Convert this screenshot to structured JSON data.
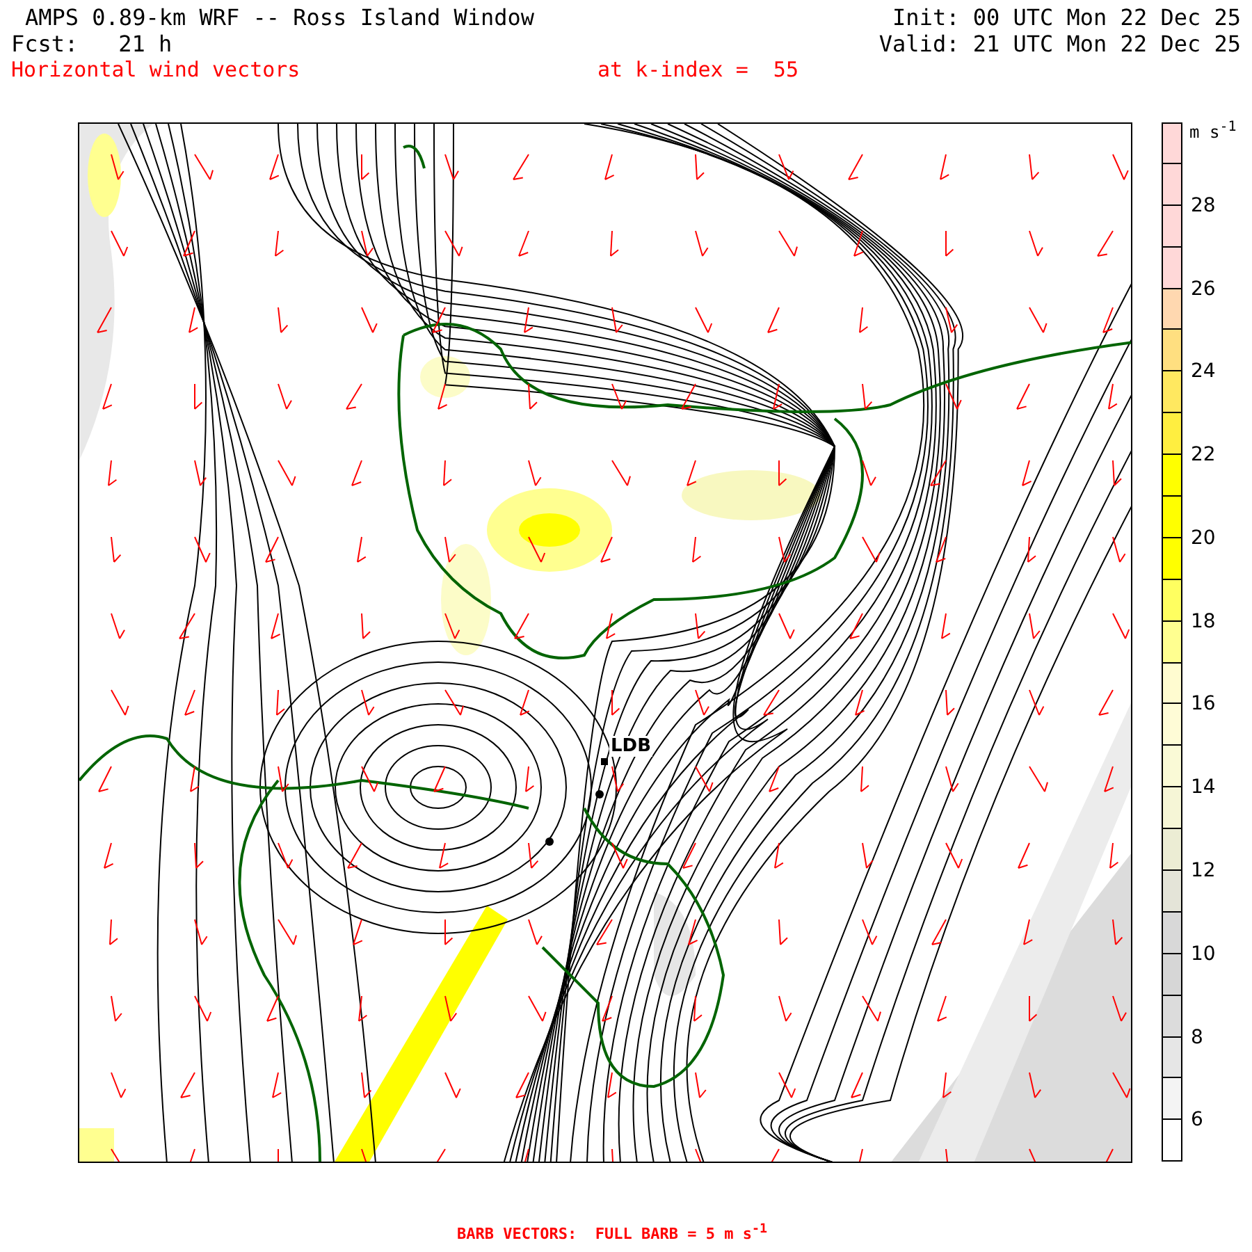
{
  "header": {
    "title": "AMPS 0.89-km WRF -- Ross Island Window",
    "init": "Init: 00 UTC Mon 22 Dec 25",
    "forecast": "Fcst:   21 h",
    "valid": "Valid: 21 UTC Mon 22 Dec 25",
    "field": "Horizontal wind vectors",
    "level": "at k-index =  55"
  },
  "map": {
    "station_label": "LDB"
  },
  "colorbar": {
    "unit": "m s$^{-1}$",
    "segments": [
      {
        "color": "#ffd8d8"
      },
      {
        "color": "#ffd8d8"
      },
      {
        "color": "#ffd8d8"
      },
      {
        "color": "#ffd8d8"
      },
      {
        "color": "#ffd8b0"
      },
      {
        "color": "#ffdf80"
      },
      {
        "color": "#ffe860"
      },
      {
        "color": "#ffee40"
      },
      {
        "color": "#ffff00"
      },
      {
        "color": "#ffff00"
      },
      {
        "color": "#ffff00"
      },
      {
        "color": "#ffff60"
      },
      {
        "color": "#ffff90"
      },
      {
        "color": "#fffcd0"
      },
      {
        "color": "#fefcd6"
      },
      {
        "color": "#fafad6"
      },
      {
        "color": "#f6f6d6"
      },
      {
        "color": "#ecedd4"
      },
      {
        "color": "#e4e4d8"
      },
      {
        "color": "#d8d8d8"
      },
      {
        "color": "#d6d6d6"
      },
      {
        "color": "#dcdcdc"
      },
      {
        "color": "#e6e6e6"
      },
      {
        "color": "#f4f4f4"
      },
      {
        "color": "#ffffff"
      }
    ],
    "ticks": [
      "28",
      "26",
      "24",
      "22",
      "20",
      "18",
      "16",
      "14",
      "12",
      "10",
      "8",
      "6"
    ]
  },
  "footer": "BARB VECTORS:  FULL BARB = 5 m s$^{-1}$"
}
